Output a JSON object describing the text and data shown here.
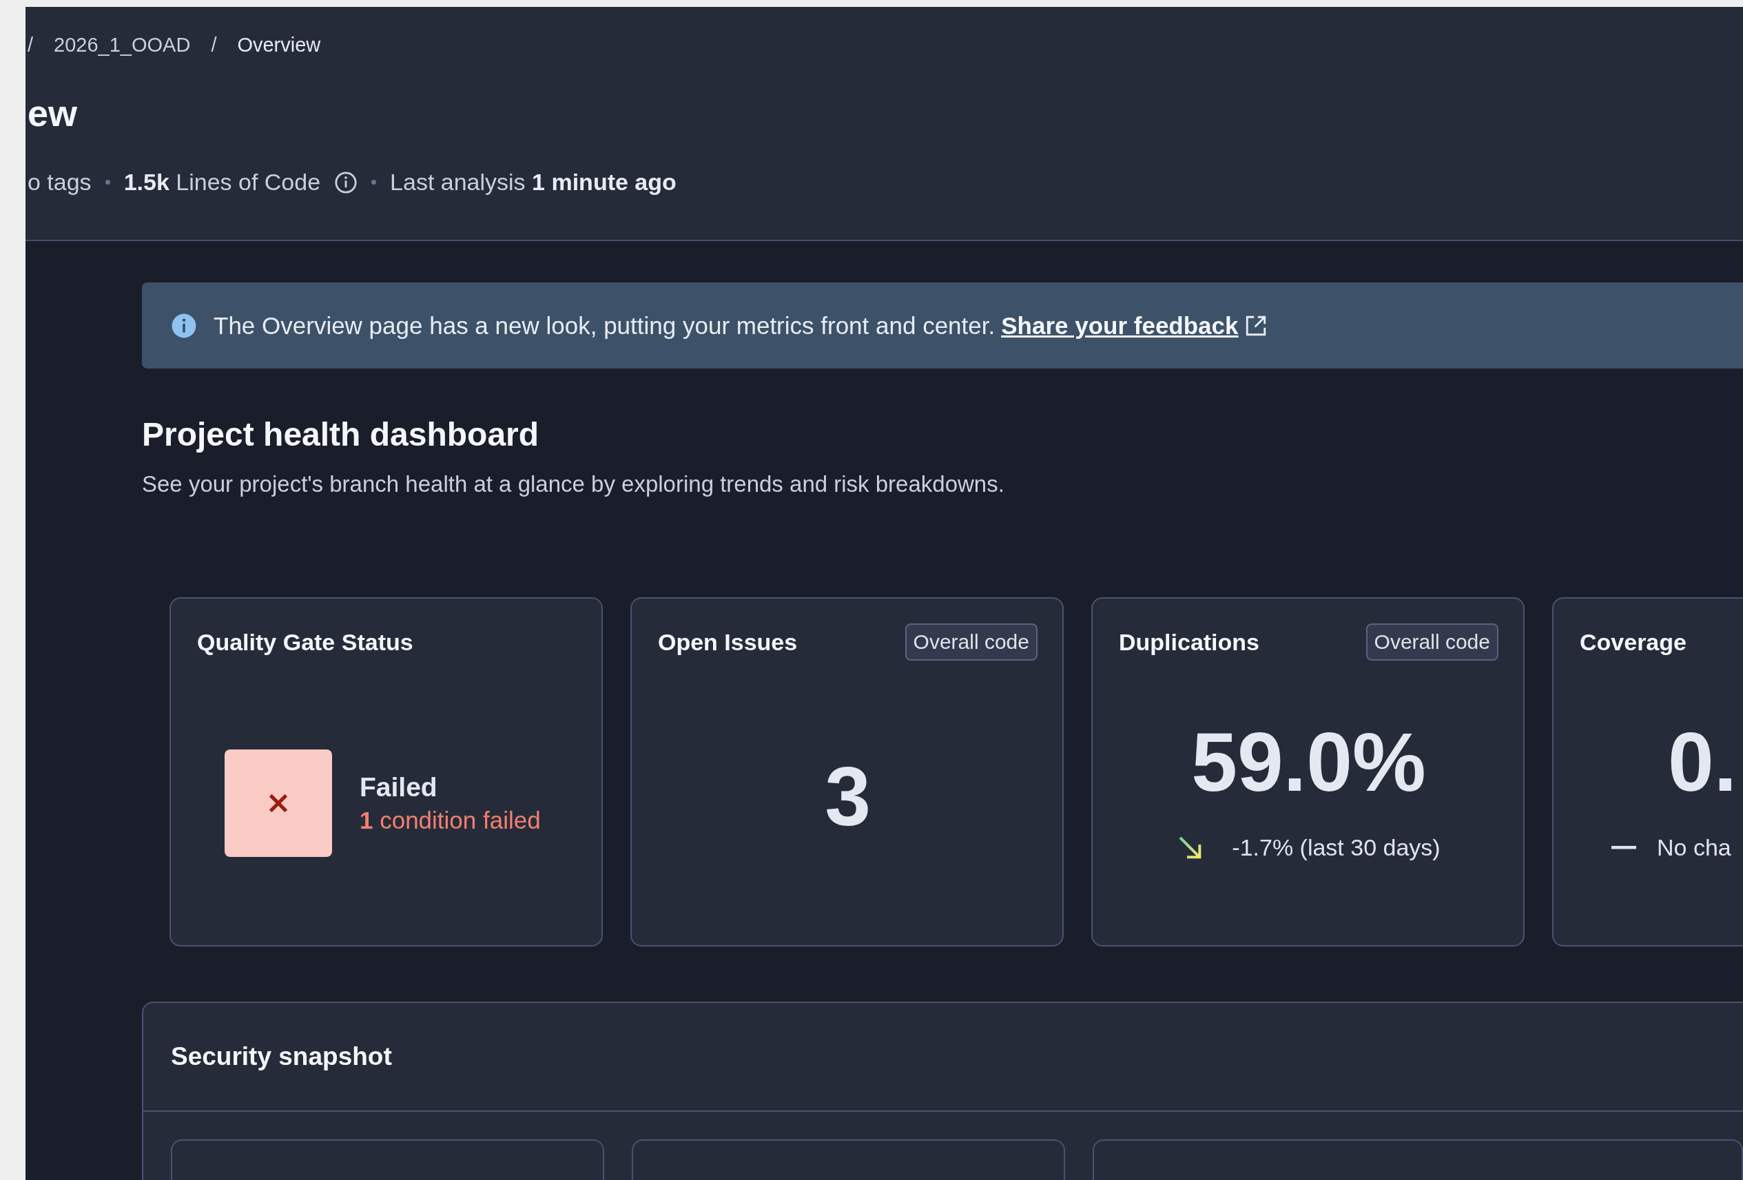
{
  "breadcrumb": [
    {
      "kind": "separator",
      "text": "/"
    },
    {
      "kind": "crumb",
      "text": "2026_1_OOAD"
    },
    {
      "kind": "separator",
      "text": "/"
    },
    {
      "kind": "current",
      "text": "Overview"
    }
  ],
  "page_title": "ew",
  "meta": {
    "tags": "o tags",
    "lines_of_code": "**1.5k** Lines of Code",
    "last_analysis": "Last analysis **1 minute ago**"
  },
  "banner": {
    "text": "The Overview page has a new look, putting your metrics front and center.",
    "link": "Share your feedback"
  },
  "dashboard": {
    "title": "Project health dashboard",
    "subtitle": "See your project's branch health at a glance by exploring trends and risk breakdowns."
  },
  "metric_cards": [
    {
      "kind": "quality_gate",
      "title": "Quality Gate Status",
      "passed": false,
      "label": "Failed",
      "detail": "**1** condition failed"
    },
    {
      "kind": "count",
      "title": "Open Issues",
      "badge": "Overall code",
      "value": "3"
    },
    {
      "kind": "percentage",
      "title": "Duplications",
      "badge": "Overall code",
      "value": "59.0%",
      "trend": {
        "kind": "down",
        "text": "-1.7% (last 30 days)"
      }
    },
    {
      "kind": "percentage",
      "title": "Coverage",
      "value": "0.",
      "trend": {
        "kind": "flat",
        "text": "No cha"
      }
    }
  ],
  "security_snapshot": {
    "title": "Security snapshot",
    "cards": [
      {
        "kind": "panel"
      },
      {
        "kind": "panel"
      },
      {
        "kind": "wide"
      }
    ]
  }
}
